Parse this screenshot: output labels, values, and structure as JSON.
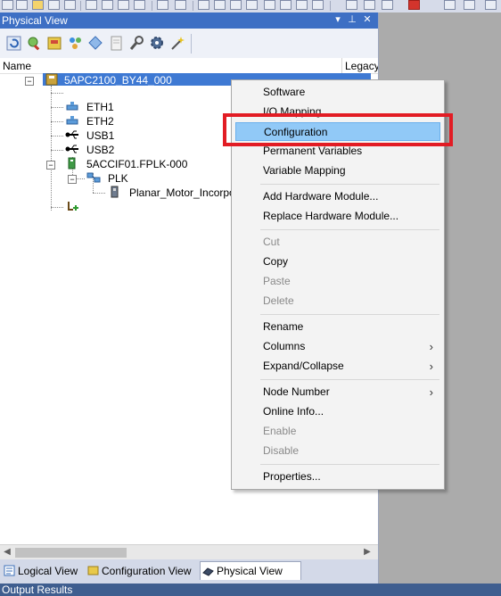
{
  "panel": {
    "title": "Physical View",
    "pin_glyph": "▾",
    "autohide_glyph": "⊥",
    "close_glyph": "✕"
  },
  "toolbar": {
    "icons": [
      "refresh-icon",
      "search-icon",
      "module-icon",
      "network-icon",
      "diamond-icon",
      "page-icon",
      "wrench-icon",
      "cog-icon",
      "magic-icon"
    ]
  },
  "columns": {
    "name": "Name",
    "legacy": "Legacy"
  },
  "tree": {
    "root": "5APC2100_BY44_000",
    "eth1": "ETH1",
    "eth2": "ETH2",
    "usb1": "USB1",
    "usb2": "USB2",
    "if_module": "5ACCIF01.FPLK-000",
    "plk": "PLK",
    "planar": "Planar_Motor_Incorporated",
    "expand_minus": "−"
  },
  "context_menu": {
    "items": [
      {
        "label": "Software",
        "enabled": true
      },
      {
        "label": "I/O Mapping",
        "enabled": true
      },
      {
        "label": "Configuration",
        "enabled": true,
        "highlighted": true
      },
      {
        "label": "Permanent Variables",
        "enabled": true
      },
      {
        "label": "Variable Mapping",
        "enabled": true
      },
      {
        "label": "Add Hardware Module...",
        "enabled": true
      },
      {
        "label": "Replace Hardware Module...",
        "enabled": true
      },
      {
        "label": "Cut",
        "enabled": false
      },
      {
        "label": "Copy",
        "enabled": true
      },
      {
        "label": "Paste",
        "enabled": false
      },
      {
        "label": "Delete",
        "enabled": false
      },
      {
        "label": "Rename",
        "enabled": true
      },
      {
        "label": "Columns",
        "enabled": true,
        "submenu": true
      },
      {
        "label": "Expand/Collapse",
        "enabled": true,
        "submenu": true
      },
      {
        "label": "Node Number",
        "enabled": true,
        "submenu": true
      },
      {
        "label": "Online Info...",
        "enabled": true
      },
      {
        "label": "Enable",
        "enabled": false
      },
      {
        "label": "Disable",
        "enabled": false
      },
      {
        "label": "Properties...",
        "enabled": true
      }
    ],
    "submenu_glyph": "›"
  },
  "tabs": [
    {
      "label": "Logical View",
      "active": false
    },
    {
      "label": "Configuration View",
      "active": false
    },
    {
      "label": "Physical View",
      "active": true
    }
  ],
  "scrollbar": {
    "left_arrow": "◀",
    "right_arrow": "▶"
  },
  "output": {
    "title": "Output Results"
  },
  "colors": {
    "title_bar": "#3d6fc4",
    "selection": "#3e79d3",
    "menu_highlight": "#91c9f7",
    "annotation_box": "#e21c24"
  }
}
